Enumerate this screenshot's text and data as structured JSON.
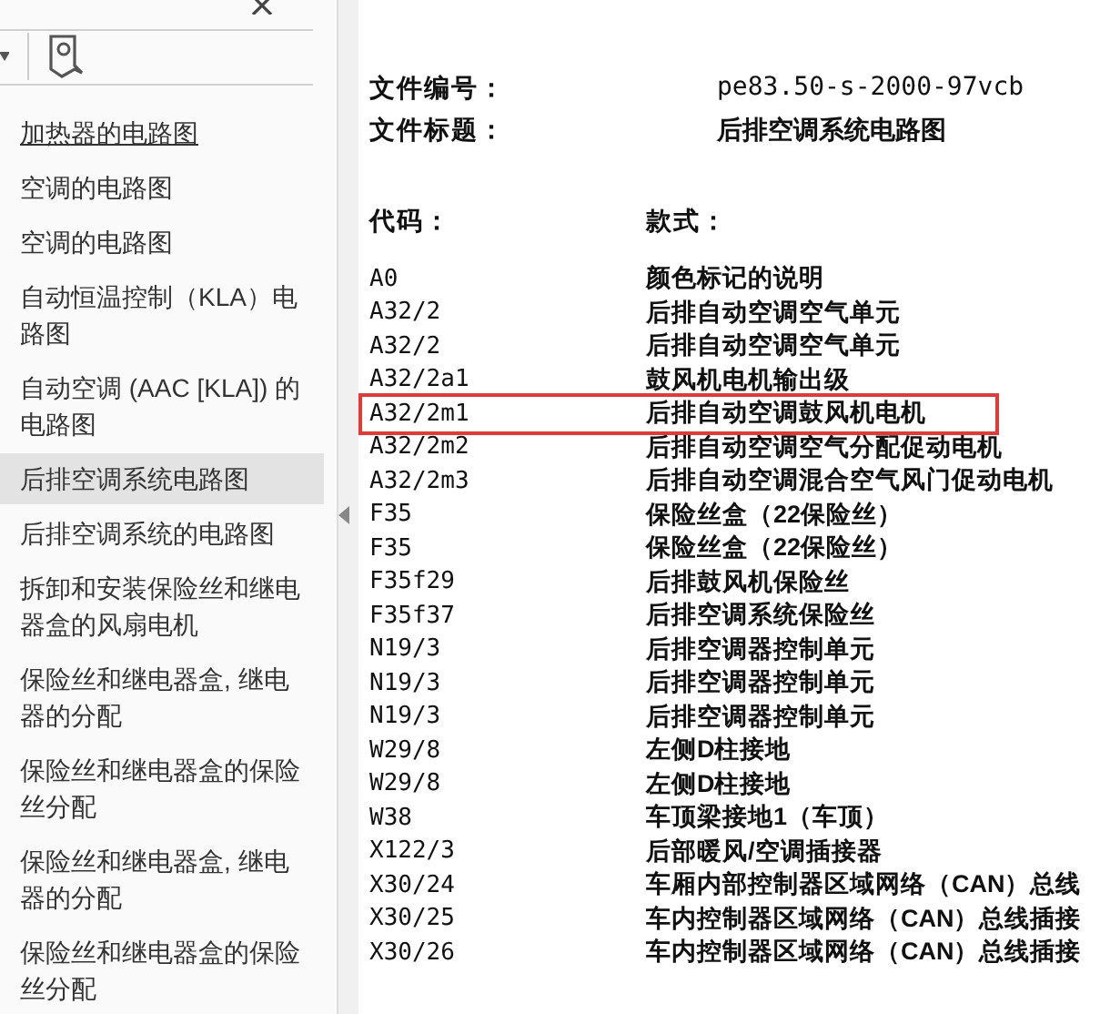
{
  "sidebar": {
    "items": [
      {
        "label": "加热器的电路图",
        "selected": false,
        "underlined": true
      },
      {
        "label": "空调的电路图",
        "selected": false,
        "underlined": false
      },
      {
        "label": "空调的电路图",
        "selected": false,
        "underlined": false
      },
      {
        "label": "自动恒温控制（KLA）电路图",
        "selected": false,
        "underlined": false
      },
      {
        "label": "自动空调 (AAC [KLA]) 的电路图",
        "selected": false,
        "underlined": false
      },
      {
        "label": "后排空调系统电路图",
        "selected": true,
        "underlined": false
      },
      {
        "label": "后排空调系统的电路图",
        "selected": false,
        "underlined": false
      },
      {
        "label": "拆卸和安装保险丝和继电器盒的风扇电机",
        "selected": false,
        "underlined": false
      },
      {
        "label": "保险丝和继电器盒, 继电器的分配",
        "selected": false,
        "underlined": false
      },
      {
        "label": "保险丝和继电器盒的保险丝分配",
        "selected": false,
        "underlined": false
      },
      {
        "label": "保险丝和继电器盒, 继电器的分配",
        "selected": false,
        "underlined": false
      },
      {
        "label": "保险丝和继电器盒的保险丝分配",
        "selected": false,
        "underlined": false
      }
    ]
  },
  "document": {
    "fields": [
      {
        "label": "文件编号：",
        "value": "pe83.50-s-2000-97vcb"
      },
      {
        "label": "文件标题：",
        "value": "后排空调系统电路图"
      }
    ],
    "columns": [
      "代码：",
      "款式："
    ],
    "rows": [
      {
        "code": "A0",
        "description": "颜色标记的说明",
        "highlighted": false
      },
      {
        "code": "A32/2",
        "description": "后排自动空调空气单元",
        "highlighted": false
      },
      {
        "code": "A32/2",
        "description": "后排自动空调空气单元",
        "highlighted": false
      },
      {
        "code": "A32/2a1",
        "description": "鼓风机电机输出级",
        "highlighted": false
      },
      {
        "code": "A32/2m1",
        "description": "后排自动空调鼓风机电机",
        "highlighted": true
      },
      {
        "code": "A32/2m2",
        "description": "后排自动空调空气分配促动电机",
        "highlighted": false
      },
      {
        "code": "A32/2m3",
        "description": "后排自动空调混合空气风门促动电机",
        "highlighted": false
      },
      {
        "code": "F35",
        "description": "保险丝盒（22保险丝）",
        "highlighted": false
      },
      {
        "code": "F35",
        "description": "保险丝盒（22保险丝）",
        "highlighted": false
      },
      {
        "code": "F35f29",
        "description": "后排鼓风机保险丝",
        "highlighted": false
      },
      {
        "code": "F35f37",
        "description": "后排空调系统保险丝",
        "highlighted": false
      },
      {
        "code": "N19/3",
        "description": "后排空调器控制单元",
        "highlighted": false
      },
      {
        "code": "N19/3",
        "description": "后排空调器控制单元",
        "highlighted": false
      },
      {
        "code": "N19/3",
        "description": "后排空调器控制单元",
        "highlighted": false
      },
      {
        "code": "W29/8",
        "description": "左侧D柱接地",
        "highlighted": false
      },
      {
        "code": "W29/8",
        "description": "左侧D柱接地",
        "highlighted": false
      },
      {
        "code": "W38",
        "description": "车顶梁接地1（车顶）",
        "highlighted": false
      },
      {
        "code": "X122/3",
        "description": "后部暖风/空调插接器",
        "highlighted": false
      },
      {
        "code": "X30/24",
        "description": "车厢内部控制器区域网络（CAN）总线",
        "highlighted": false
      },
      {
        "code": "X30/25",
        "description": "车内控制器区域网络（CAN）总线插接",
        "highlighted": false
      },
      {
        "code": "X30/26",
        "description": "车内控制器区域网络（CAN）总线插接",
        "highlighted": false
      }
    ]
  }
}
